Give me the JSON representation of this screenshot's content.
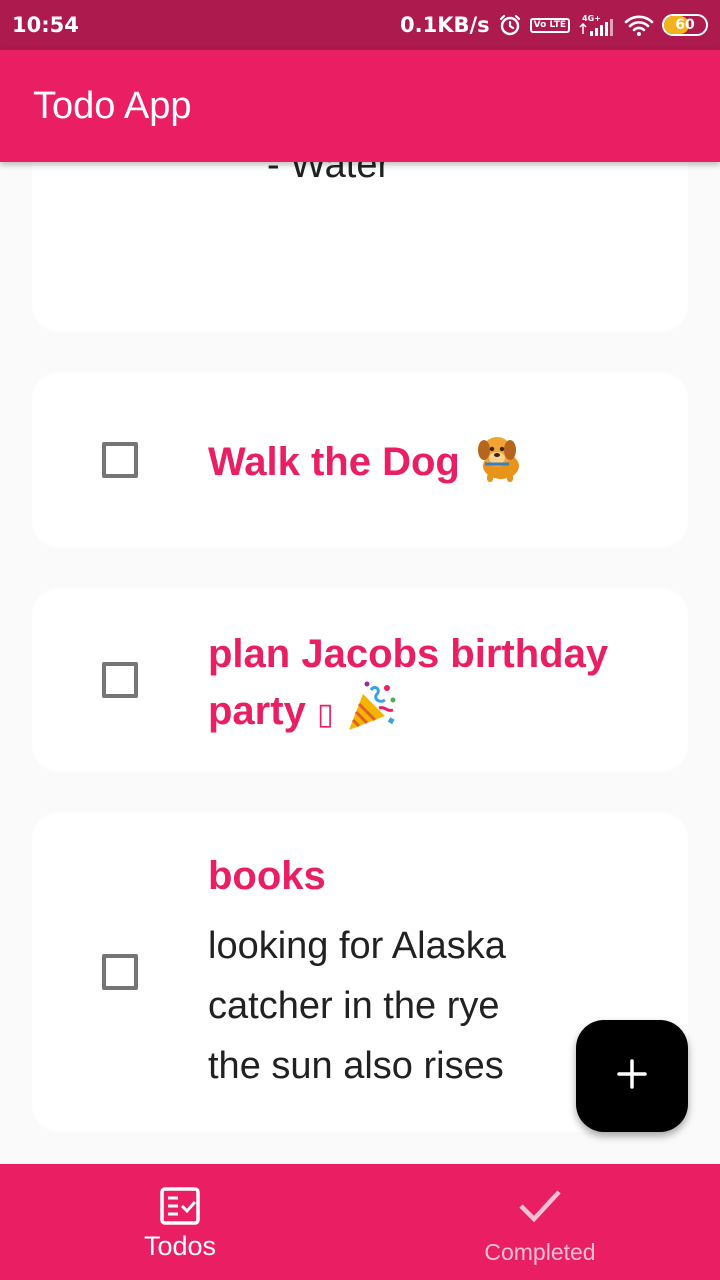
{
  "status_bar": {
    "time": "10:54",
    "net_speed": "0.1KB/s",
    "volte": "Vo LTE",
    "network": "4G+",
    "battery": "60",
    "battery_level_percent": 60,
    "icons": [
      "alarm-icon",
      "volte-icon",
      "signal-icon",
      "wifi-icon",
      "battery-icon"
    ]
  },
  "app_bar": {
    "title": "Todo App"
  },
  "todos": {
    "partial_line": "- Water",
    "items": [
      {
        "title": "Walk the Dog",
        "body_lines": [],
        "checked": false
      },
      {
        "title": "plan Jacobs birthday party",
        "title_missing_glyph": "▯",
        "body_lines": [],
        "checked": false
      },
      {
        "title": "books",
        "body_lines": [
          "looking for Alaska",
          "catcher in the rye",
          "the sun also rises"
        ],
        "checked": false
      }
    ]
  },
  "fab": {
    "icon": "plus-icon"
  },
  "bottom_nav": {
    "items": [
      {
        "label": "Todos",
        "icon": "todo-list-icon",
        "active": true
      },
      {
        "label": "Completed",
        "icon": "check-icon",
        "active": false
      }
    ]
  },
  "colors": {
    "primary": "#e91e63",
    "status_bar": "#ad1a4d",
    "background": "#fafafa",
    "card": "#ffffff",
    "fab": "#000000"
  }
}
